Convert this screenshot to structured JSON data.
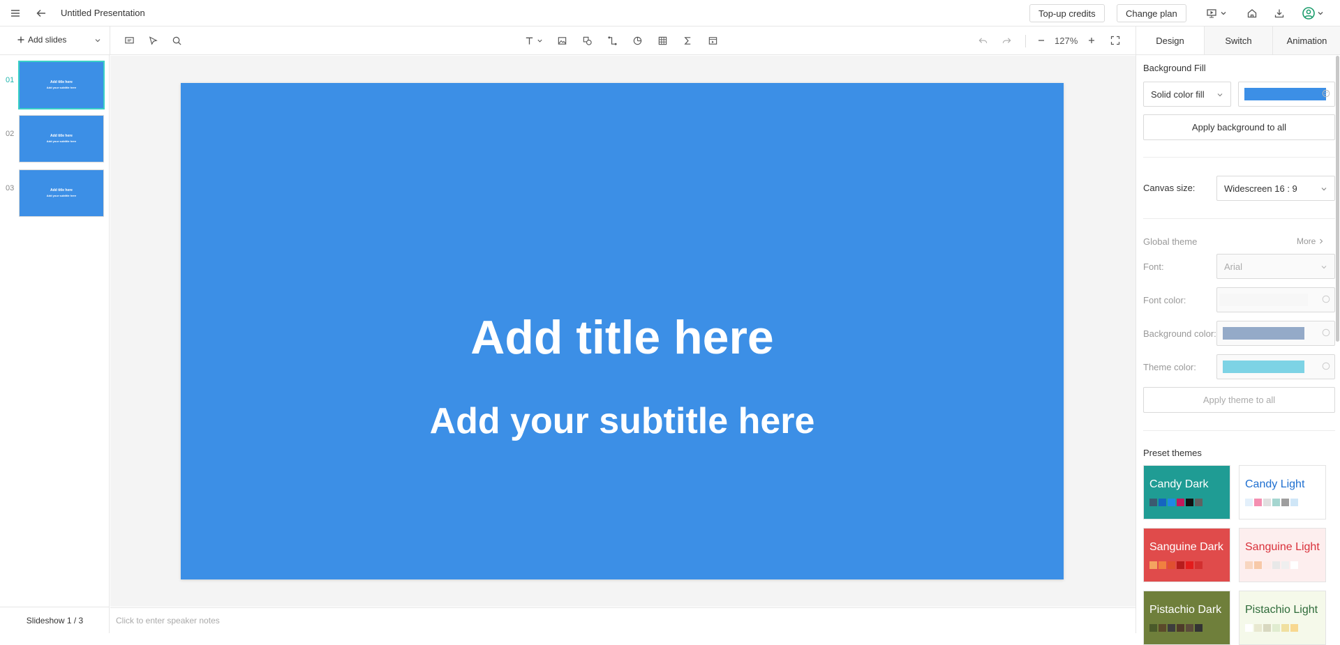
{
  "header": {
    "doc_title": "Untitled Presentation",
    "topup_label": "Top-up credits",
    "change_plan_label": "Change plan"
  },
  "toolbar": {
    "add_slides_label": "Add slides",
    "zoom_level": "127%"
  },
  "slides": [
    {
      "number": "01",
      "title": "Add title here",
      "subtitle": "Add your subtitle here",
      "active": true
    },
    {
      "number": "02",
      "title": "Add title here",
      "subtitle": "Add your subtitle here",
      "active": false
    },
    {
      "number": "03",
      "title": "Add title here",
      "subtitle": "Add your subtitle here",
      "active": false
    }
  ],
  "footer": {
    "slideshow_label": "Slideshow 1 / 3",
    "notes_placeholder": "Click to enter speaker notes"
  },
  "canvas": {
    "title": "Add title here",
    "subtitle": "Add your subtitle here",
    "background": "#3c8fe6"
  },
  "right_panel": {
    "tabs": [
      {
        "label": "Design",
        "active": true
      },
      {
        "label": "Switch",
        "active": false
      },
      {
        "label": "Animation",
        "active": false
      }
    ],
    "background_fill_label": "Background Fill",
    "fill_type": "Solid color fill",
    "fill_color": "#3c8fe6",
    "apply_bg_label": "Apply background to all",
    "canvas_size_label": "Canvas size:",
    "canvas_size_value": "Widescreen 16 : 9",
    "global_theme_label": "Global theme",
    "more_label": "More",
    "font_label": "Font:",
    "font_value": "Arial",
    "font_color_label": "Font color:",
    "bg_color_label": "Background color:",
    "bg_color": "#94aac8",
    "theme_color_label": "Theme color:",
    "theme_color": "#7dd3e5",
    "apply_theme_label": "Apply theme to all",
    "preset_themes_label": "Preset themes",
    "themes": [
      {
        "name": "Candy Dark",
        "bg": "#1f9c94",
        "text": "#ffffff",
        "chips": [
          "#3b5a70",
          "#1565c0",
          "#1e88e5",
          "#c2185b",
          "#111111",
          "#616161"
        ]
      },
      {
        "name": "Candy Light",
        "bg": "#ffffff",
        "text": "#1e6fd0",
        "chips": [
          "#e3f0fb",
          "#f48fb1",
          "#e0e0e0",
          "#a5d6d0",
          "#9e9e9e",
          "#cfe6f7"
        ]
      },
      {
        "name": "Sanguine Dark",
        "bg": "#e04b4b",
        "text": "#ffffff",
        "chips": [
          "#f4a460",
          "#f08040",
          "#e05030",
          "#b71c1c",
          "#e31c1c",
          "#d32f2f"
        ]
      },
      {
        "name": "Sanguine Light",
        "bg": "#fdeeee",
        "text": "#d9303a",
        "chips": [
          "#f8d6c0",
          "#f7c9a8",
          "#fdecea",
          "#e8e8e8",
          "#efefef",
          "#ffffff"
        ]
      },
      {
        "name": "Pistachio Dark",
        "bg": "#6f7f3b",
        "text": "#ffffff",
        "chips": [
          "#4a5a2a",
          "#5b4a2a",
          "#3d3d3d",
          "#4e3b2a",
          "#5a4a3a",
          "#333333"
        ]
      },
      {
        "name": "Pistachio Light",
        "bg": "#f5f9ea",
        "text": "#2e6b3a",
        "chips": [
          "#ffffff",
          "#e8e8d0",
          "#d8d8c0",
          "#e0ecd0",
          "#f0e0a0",
          "#f8d890"
        ]
      }
    ]
  }
}
